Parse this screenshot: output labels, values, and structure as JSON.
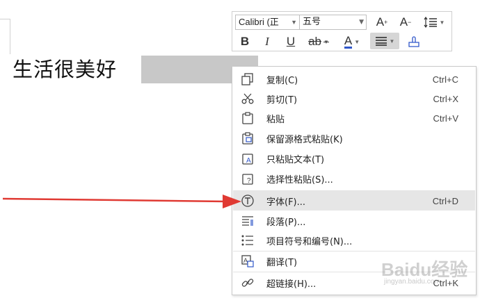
{
  "document": {
    "text": "生活很美好"
  },
  "toolbar": {
    "font_name": "Calibri (正",
    "font_size": "五号",
    "grow_font": "A",
    "shrink_font": "A",
    "bold": "B",
    "italic": "I",
    "underline": "U",
    "strike": "ab",
    "font_color": "A"
  },
  "context_menu": {
    "items": [
      {
        "label": "复制(C)",
        "shortcut": "Ctrl+C",
        "icon": "copy-icon"
      },
      {
        "label": "剪切(T)",
        "shortcut": "Ctrl+X",
        "icon": "scissors-icon"
      },
      {
        "label": "粘贴",
        "shortcut": "Ctrl+V",
        "icon": "paste-icon"
      },
      {
        "label": "保留源格式粘贴(K)",
        "shortcut": "",
        "icon": "paste-keep-format-icon"
      },
      {
        "label": "只粘贴文本(T)",
        "shortcut": "",
        "icon": "paste-text-only-icon"
      },
      {
        "label": "选择性粘贴(S)...",
        "shortcut": "",
        "icon": "paste-special-icon"
      },
      {
        "label": "字体(F)...",
        "shortcut": "Ctrl+D",
        "icon": "font-icon"
      },
      {
        "label": "段落(P)...",
        "shortcut": "",
        "icon": "paragraph-icon"
      },
      {
        "label": "项目符号和编号(N)...",
        "shortcut": "",
        "icon": "bullets-icon"
      },
      {
        "label": "翻译(T)",
        "shortcut": "",
        "icon": "translate-icon"
      },
      {
        "label": "超链接(H)...",
        "shortcut": "Ctrl+K",
        "icon": "link-icon"
      }
    ]
  },
  "watermark": {
    "text": "Baidu经验",
    "sub": "jingyan.baidu.com"
  },
  "colors": {
    "arrow": "#e03a33",
    "highlight": "#e6e6e6",
    "font_color_bar": "#2f56c9"
  }
}
